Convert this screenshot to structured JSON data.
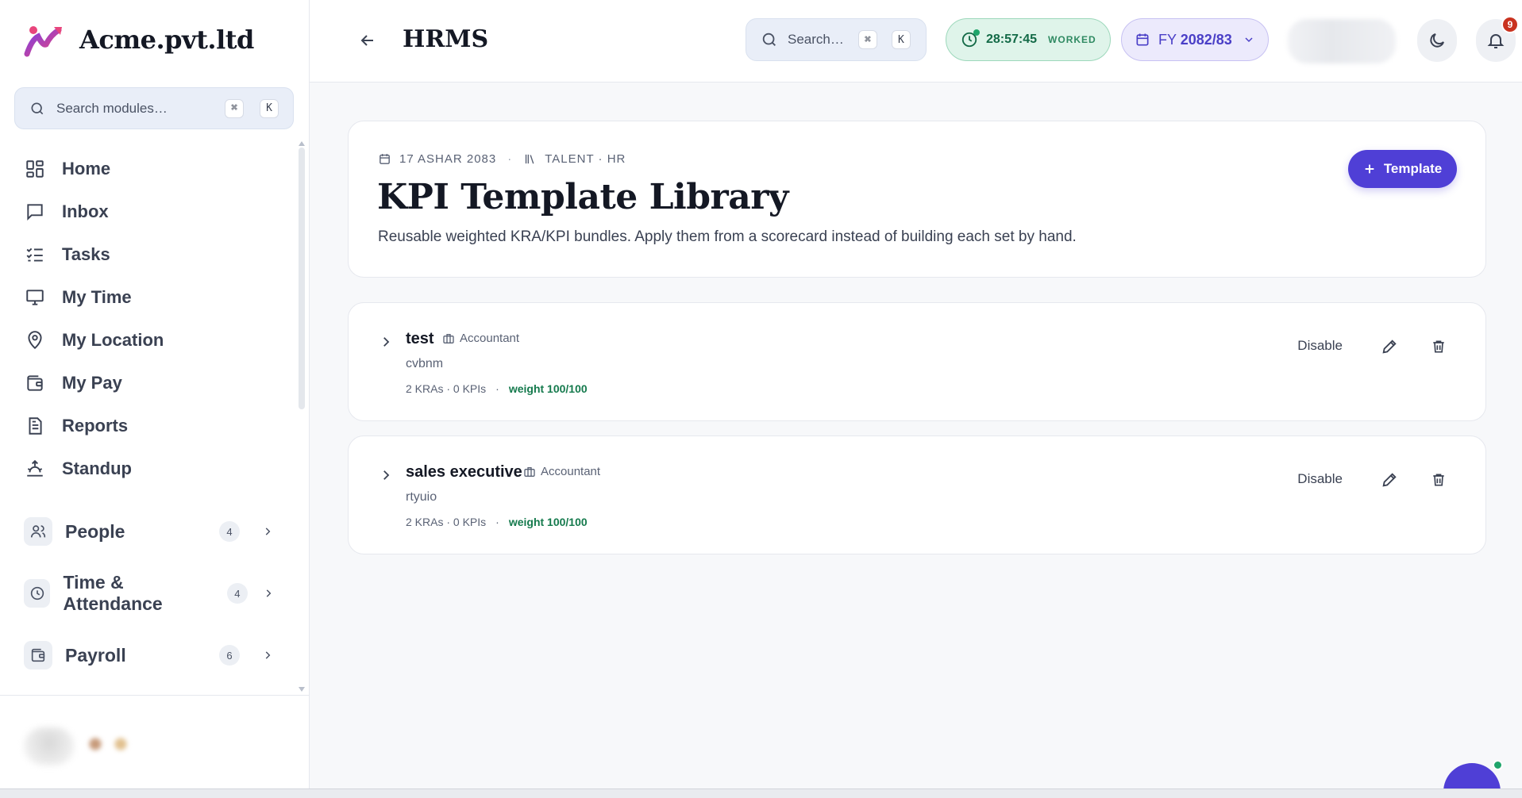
{
  "brand": {
    "name": "Acme.pvt.ltd"
  },
  "sidebar": {
    "search": {
      "placeholder": "Search modules…",
      "kbd_cmd": "⌘",
      "kbd_key": "K"
    },
    "items": [
      {
        "label": "Home",
        "icon": "grid-icon"
      },
      {
        "label": "Inbox",
        "icon": "message-square-icon"
      },
      {
        "label": "Tasks",
        "icon": "list-checks-icon"
      },
      {
        "label": "My Time",
        "icon": "monitor-icon"
      },
      {
        "label": "My Location",
        "icon": "map-pin-icon"
      },
      {
        "label": "My Pay",
        "icon": "wallet-icon"
      },
      {
        "label": "Reports",
        "icon": "file-text-icon"
      },
      {
        "label": "Standup",
        "icon": "sunrise-icon"
      }
    ],
    "groups": [
      {
        "label": "People",
        "count": "4",
        "icon": "users-icon"
      },
      {
        "label": "Time & Attendance",
        "count": "4",
        "icon": "clock-icon"
      },
      {
        "label": "Payroll",
        "count": "6",
        "icon": "wallet-icon"
      }
    ]
  },
  "header": {
    "title": "HRMS",
    "search": {
      "placeholder": "Search…",
      "kbd_cmd": "⌘",
      "kbd_key": "K"
    },
    "timer": {
      "time": "28:57:45",
      "label": "WORKED"
    },
    "fiscal_year": {
      "prefix": "FY",
      "value": "2082/83"
    },
    "notifications": {
      "count": "9"
    }
  },
  "page": {
    "date": "17 ASHAR 2083",
    "section": "TALENT · HR",
    "title": "KPI Template Library",
    "subtitle": "Reusable weighted KRA/KPI bundles. Apply them from a scorecard instead of building each set by hand.",
    "add_button": "Template"
  },
  "templates": [
    {
      "name": "test",
      "role": "Accountant",
      "description": "cvbnm",
      "stats": "2 KRAs · 0 KPIs",
      "weight": "weight 100/100",
      "disable_label": "Disable"
    },
    {
      "name": "sales executive",
      "role": "Accountant",
      "description": "rtyuio",
      "stats": "2 KRAs · 0 KPIs",
      "weight": "weight 100/100",
      "disable_label": "Disable"
    }
  ],
  "colors": {
    "accent": "#4f3fd6",
    "success": "#157a4d",
    "timer_bg": "#dff4ea",
    "fy_bg": "#eceafc",
    "badge": "#c9321f"
  }
}
